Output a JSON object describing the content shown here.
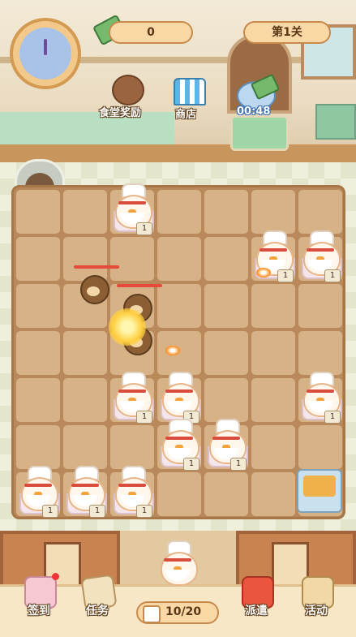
{
  "hud": {
    "coins": "0",
    "level": "第1关",
    "timer": "00:48"
  },
  "top_buttons": {
    "canteen_reward": "食堂奖励",
    "shop": "商店"
  },
  "board": {
    "rows": 7,
    "cols": 7,
    "chickens": [
      {
        "row": 0,
        "col": 2,
        "level": "1"
      },
      {
        "row": 1,
        "col": 5,
        "level": "1"
      },
      {
        "row": 1,
        "col": 6,
        "level": "1"
      },
      {
        "row": 4,
        "col": 2,
        "level": "1"
      },
      {
        "row": 4,
        "col": 3,
        "level": "1"
      },
      {
        "row": 4,
        "col": 6,
        "level": "1"
      },
      {
        "row": 5,
        "col": 3,
        "level": "1"
      },
      {
        "row": 5,
        "col": 4,
        "level": "1"
      },
      {
        "row": 6,
        "col": 0,
        "level": "1"
      },
      {
        "row": 6,
        "col": 1,
        "level": "1"
      },
      {
        "row": 6,
        "col": 2,
        "level": "1"
      }
    ],
    "enemies": [
      {
        "row": 1.7,
        "col": 1.3,
        "hp": 1
      },
      {
        "row": 2.1,
        "col": 2.2,
        "hp": 1
      },
      {
        "row": 2.8,
        "col": 2.2,
        "hp": 0.5
      }
    ]
  },
  "bottom_bar": {
    "checkin": "签到",
    "tasks": "任务",
    "capacity": "10/20",
    "dispatch": "派遣",
    "events": "活动"
  }
}
